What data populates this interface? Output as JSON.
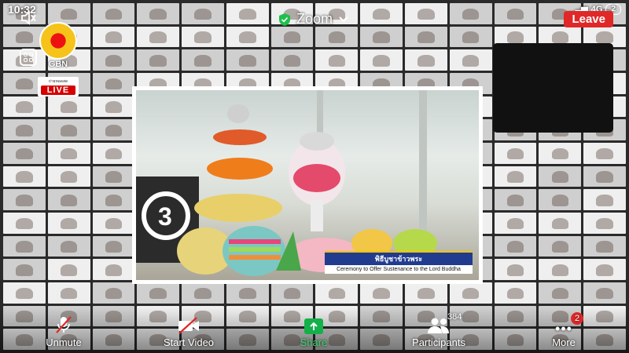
{
  "status_bar": {
    "time": "10:32",
    "network": "4G",
    "battery": "2"
  },
  "meeting": {
    "title": "Zoom",
    "leave_label": "Leave"
  },
  "broadcaster": {
    "logo_text": "GBN",
    "badge_line1": "ถ่ายทอดสด",
    "badge_live": "LIVE"
  },
  "shared_screen": {
    "caption_thai": "พิธีบูชาข้าวพระ",
    "caption_en": "Ceremony to Offer Sustenance to the Lord Buddha",
    "scene_number": "3"
  },
  "toolbar": {
    "unmute_label": "Unmute",
    "start_video_label": "Start Video",
    "share_label": "Share",
    "participants_label": "Participants",
    "participants_count": "384",
    "more_label": "More",
    "more_badge": "2"
  },
  "colors": {
    "leave": "#e02828",
    "share": "#14b04a",
    "caption_blue": "#213b8f"
  }
}
